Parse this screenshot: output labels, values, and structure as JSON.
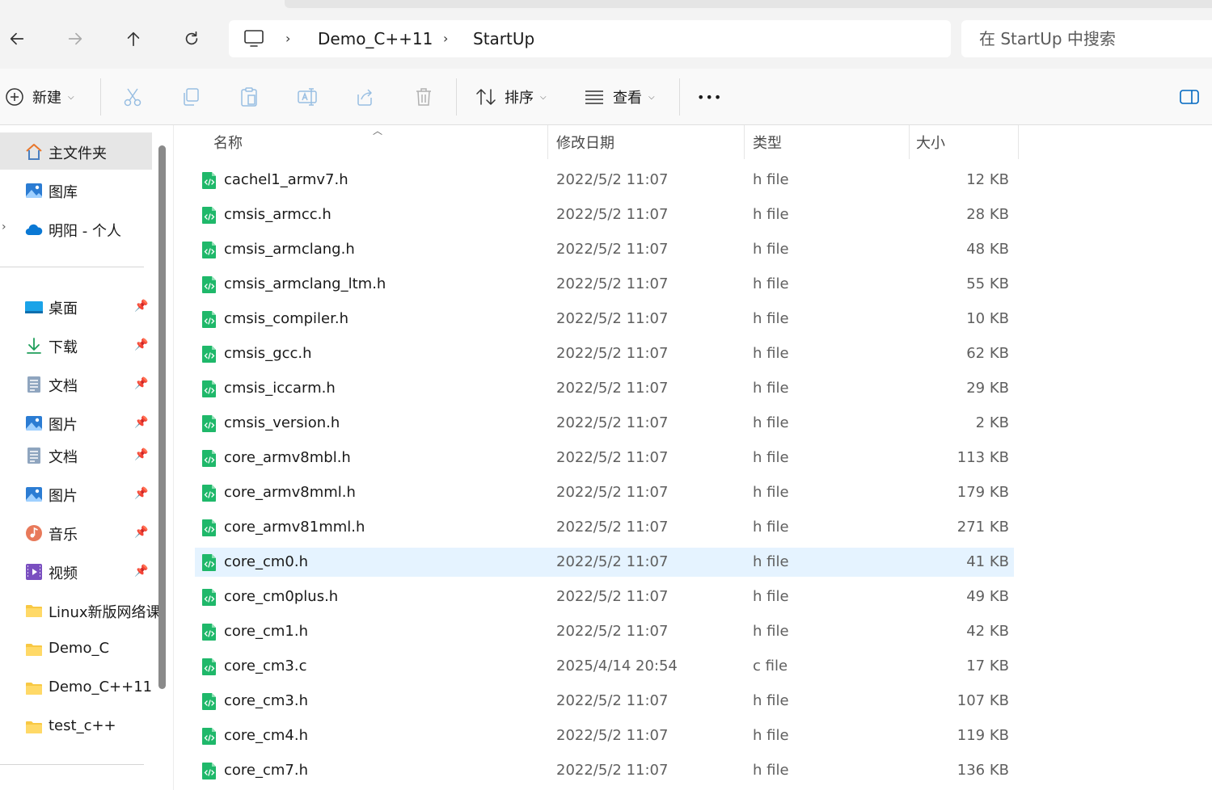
{
  "address": {
    "crumbs": [
      "Demo_C++11",
      "StartUp"
    ]
  },
  "search": {
    "placeholder": "在 StartUp 中搜索"
  },
  "toolbar": {
    "new_label": "新建",
    "sort_label": "排序",
    "view_label": "查看",
    "more_label": "•••"
  },
  "sidebar": {
    "top": [
      {
        "label": "主文件夹",
        "icon": "home-icon"
      },
      {
        "label": "图库",
        "icon": "gallery-icon"
      },
      {
        "label": "明阳 - 个人",
        "icon": "onedrive-cloud-icon"
      }
    ],
    "quick": [
      {
        "label": "桌面",
        "icon": "desktop-icon",
        "pinned": true
      },
      {
        "label": "下载",
        "icon": "download-icon",
        "pinned": true
      },
      {
        "label": "文档",
        "icon": "document-icon",
        "pinned": true
      },
      {
        "label": "图片",
        "icon": "picture-icon",
        "pinned": true
      },
      {
        "label": "文档",
        "icon": "document-icon",
        "pinned": true
      },
      {
        "label": "图片",
        "icon": "picture-icon",
        "pinned": true
      },
      {
        "label": "音乐",
        "icon": "music-icon",
        "pinned": true
      },
      {
        "label": "视频",
        "icon": "video-icon",
        "pinned": true
      },
      {
        "label": "Linux新版网络课",
        "icon": "folder-icon",
        "pinned": false
      },
      {
        "label": "Demo_C",
        "icon": "folder-icon",
        "pinned": false
      },
      {
        "label": "Demo_C++11",
        "icon": "folder-icon",
        "pinned": false
      },
      {
        "label": "test_c++",
        "icon": "folder-icon",
        "pinned": false
      }
    ]
  },
  "columns": {
    "name": "名称",
    "date": "修改日期",
    "type": "类型",
    "size": "大小"
  },
  "files": [
    {
      "name": "cachel1_armv7.h",
      "date": "2022/5/2 11:07",
      "type": "h file",
      "size": "12 KB"
    },
    {
      "name": "cmsis_armcc.h",
      "date": "2022/5/2 11:07",
      "type": "h file",
      "size": "28 KB"
    },
    {
      "name": "cmsis_armclang.h",
      "date": "2022/5/2 11:07",
      "type": "h file",
      "size": "48 KB"
    },
    {
      "name": "cmsis_armclang_ltm.h",
      "date": "2022/5/2 11:07",
      "type": "h file",
      "size": "55 KB"
    },
    {
      "name": "cmsis_compiler.h",
      "date": "2022/5/2 11:07",
      "type": "h file",
      "size": "10 KB"
    },
    {
      "name": "cmsis_gcc.h",
      "date": "2022/5/2 11:07",
      "type": "h file",
      "size": "62 KB"
    },
    {
      "name": "cmsis_iccarm.h",
      "date": "2022/5/2 11:07",
      "type": "h file",
      "size": "29 KB"
    },
    {
      "name": "cmsis_version.h",
      "date": "2022/5/2 11:07",
      "type": "h file",
      "size": "2 KB"
    },
    {
      "name": "core_armv8mbl.h",
      "date": "2022/5/2 11:07",
      "type": "h file",
      "size": "113 KB"
    },
    {
      "name": "core_armv8mml.h",
      "date": "2022/5/2 11:07",
      "type": "h file",
      "size": "179 KB"
    },
    {
      "name": "core_armv81mml.h",
      "date": "2022/5/2 11:07",
      "type": "h file",
      "size": "271 KB"
    },
    {
      "name": "core_cm0.h",
      "date": "2022/5/2 11:07",
      "type": "h file",
      "size": "41 KB",
      "selected": true
    },
    {
      "name": "core_cm0plus.h",
      "date": "2022/5/2 11:07",
      "type": "h file",
      "size": "49 KB"
    },
    {
      "name": "core_cm1.h",
      "date": "2022/5/2 11:07",
      "type": "h file",
      "size": "42 KB"
    },
    {
      "name": "core_cm3.c",
      "date": "2025/4/14 20:54",
      "type": "c file",
      "size": "17 KB"
    },
    {
      "name": "core_cm3.h",
      "date": "2022/5/2 11:07",
      "type": "h file",
      "size": "107 KB"
    },
    {
      "name": "core_cm4.h",
      "date": "2022/5/2 11:07",
      "type": "h file",
      "size": "119 KB"
    },
    {
      "name": "core_cm7.h",
      "date": "2022/5/2 11:07",
      "type": "h file",
      "size": "136 KB"
    }
  ],
  "colors": {
    "accent": "#0067c0",
    "file_icon": "#1fb86a",
    "folder": "#f8c843",
    "selected_row": "#e5f3ff"
  }
}
